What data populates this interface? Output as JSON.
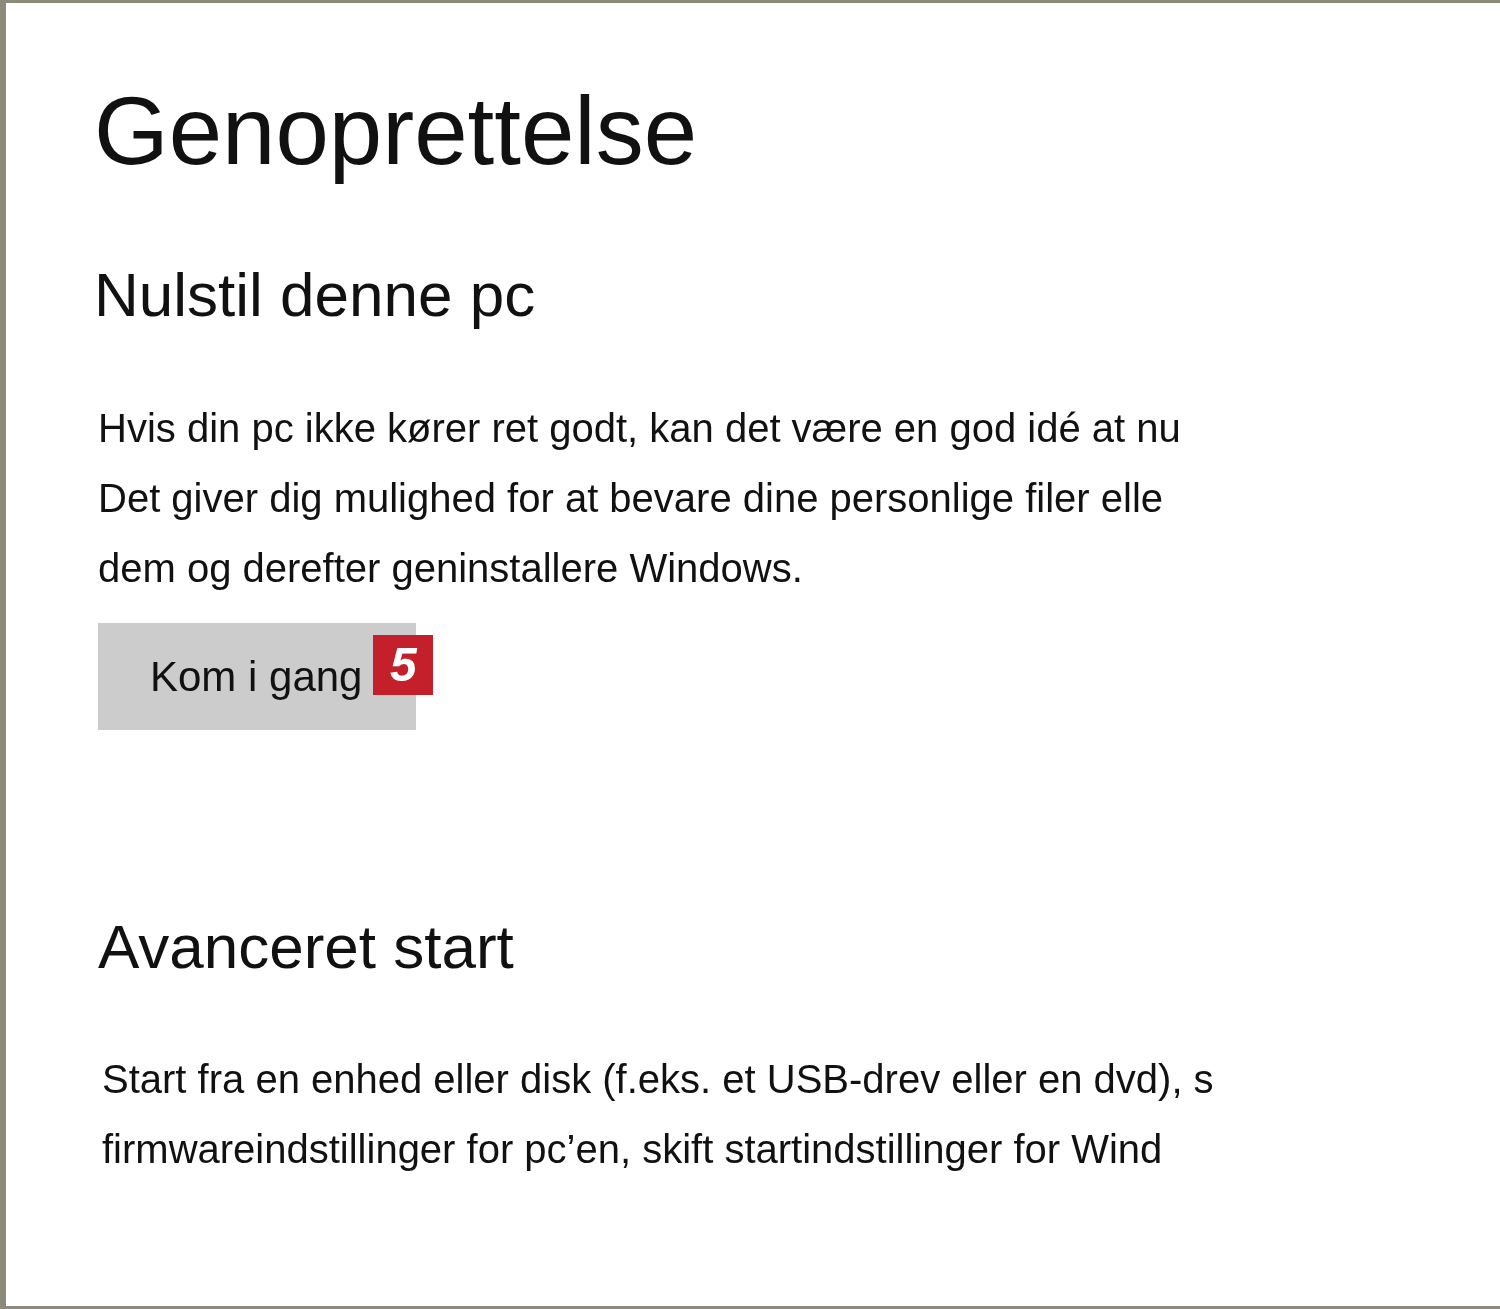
{
  "title": "Genoprettelse",
  "sections": [
    {
      "heading": "Nulstil denne pc",
      "lines": [
        "Hvis din pc ikke kører ret godt, kan det være en god idé at nu",
        "Det giver dig mulighed for at bevare dine personlige filer elle",
        "dem og derefter geninstallere Windows."
      ],
      "button": {
        "label": "Kom i gang",
        "badge": "5"
      }
    },
    {
      "heading": "Avanceret start",
      "lines": [
        "Start fra en enhed eller disk (f.eks. et USB-drev eller en dvd), s",
        "firmwareindstillinger for pc’en, skift startindstillinger for Wind"
      ]
    }
  ]
}
